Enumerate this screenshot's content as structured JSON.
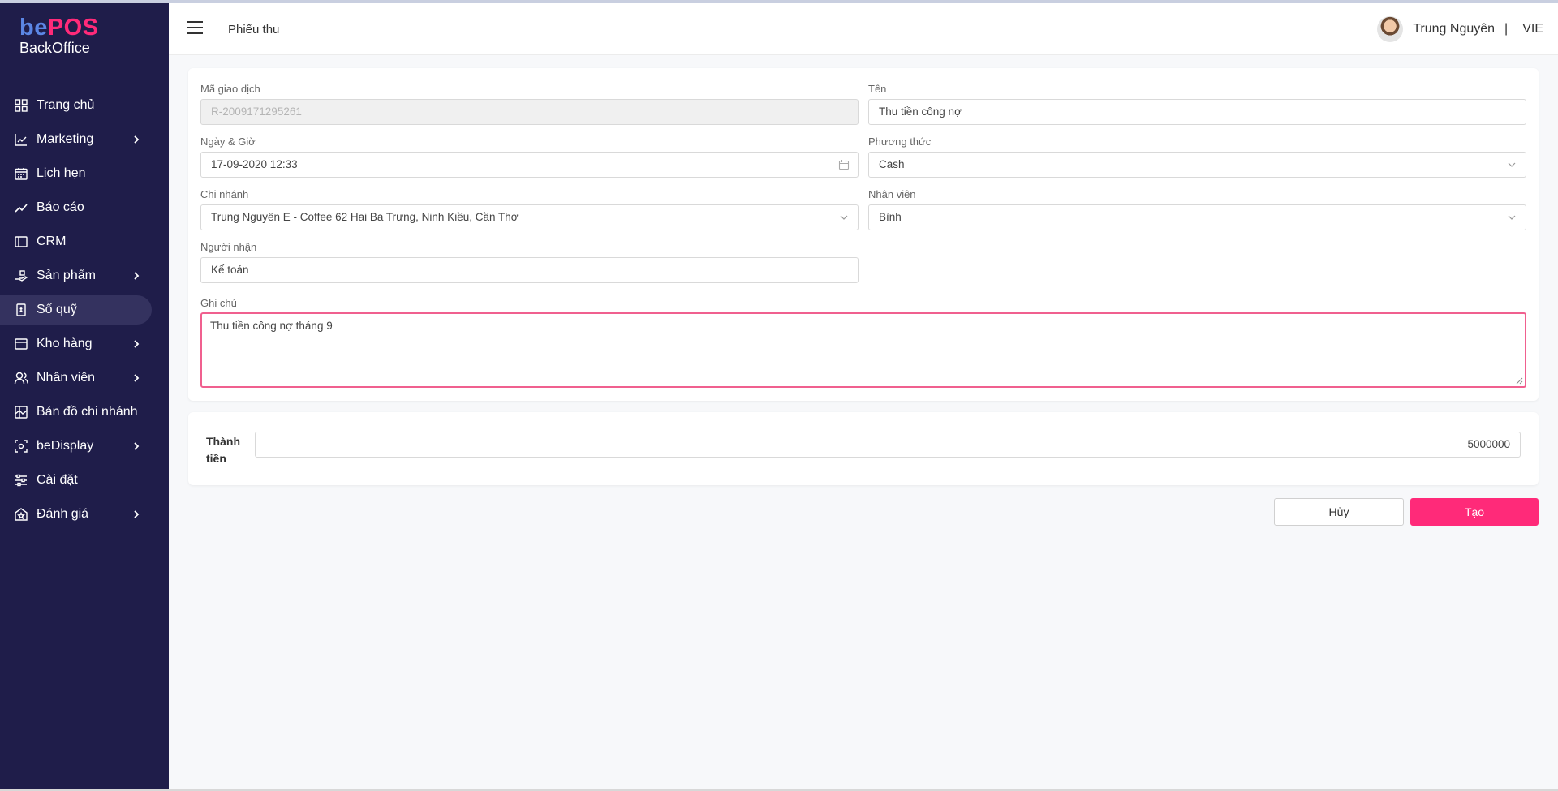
{
  "brand": {
    "be": "be",
    "pos": "POS",
    "sub": "BackOffice",
    "accent": "#ff2a79",
    "sidebar_bg": "#1f1d4a"
  },
  "sidebar": {
    "items": [
      {
        "label": "Trang chủ",
        "icon": "grid-icon",
        "has_children": false
      },
      {
        "label": "Marketing",
        "icon": "chart-icon",
        "has_children": true
      },
      {
        "label": "Lịch hẹn",
        "icon": "calendar-icon",
        "has_children": false
      },
      {
        "label": "Báo cáo",
        "icon": "trend-icon",
        "has_children": false
      },
      {
        "label": "CRM",
        "icon": "crm-icon",
        "has_children": false
      },
      {
        "label": "Sản phẩm",
        "icon": "product-icon",
        "has_children": true
      },
      {
        "label": "Sổ quỹ",
        "icon": "cashbook-icon",
        "has_children": false,
        "active": true
      },
      {
        "label": "Kho hàng",
        "icon": "warehouse-icon",
        "has_children": true
      },
      {
        "label": "Nhân viên",
        "icon": "staff-icon",
        "has_children": true
      },
      {
        "label": "Bản đồ chi nhánh",
        "icon": "map-icon",
        "has_children": false
      },
      {
        "label": "beDisplay",
        "icon": "display-icon",
        "has_children": true
      },
      {
        "label": "Cài đặt",
        "icon": "settings-icon",
        "has_children": false
      },
      {
        "label": "Đánh giá",
        "icon": "rating-icon",
        "has_children": true
      }
    ]
  },
  "header": {
    "title": "Phiếu thu",
    "user_name": "Trung Nguyên",
    "separator": "|",
    "lang": "VIE"
  },
  "form": {
    "transaction_id": {
      "label": "Mã giao dịch",
      "value": "R-2009171295261"
    },
    "name": {
      "label": "Tên",
      "value": "Thu tiền công nợ"
    },
    "datetime": {
      "label": "Ngày & Giờ",
      "value": "17-09-2020 12:33"
    },
    "method": {
      "label": "Phương thức",
      "value": "Cash"
    },
    "branch": {
      "label": "Chi nhánh",
      "value": "Trung Nguyên E - Coffee 62 Hai Ba Trưng, Ninh Kiều, Cần Thơ"
    },
    "staff": {
      "label": "Nhân viên",
      "value": "Bình"
    },
    "receiver": {
      "label": "Người nhận",
      "value": "Kế toán"
    },
    "note": {
      "label": "Ghi chú",
      "value": "Thu tiền công nợ tháng 9"
    }
  },
  "total": {
    "label": "Thành tiền",
    "value": "5000000"
  },
  "actions": {
    "cancel": "Hủy",
    "create": "Tạo"
  }
}
